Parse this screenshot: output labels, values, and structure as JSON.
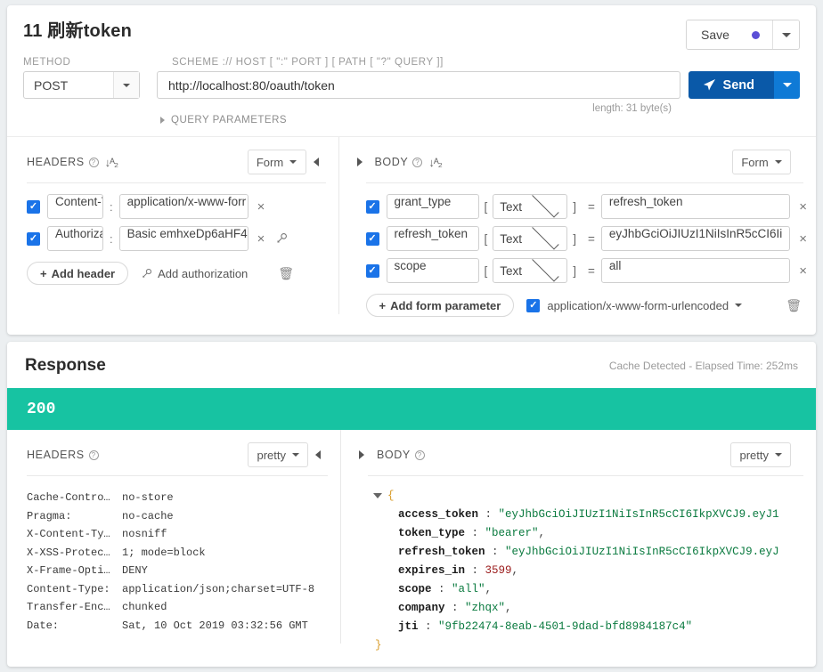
{
  "request": {
    "title": "11 刷新token",
    "save_label": "Save",
    "save_dot_color": "#5b4fd6",
    "method_label": "METHOD",
    "method_value": "POST",
    "scheme_label": "SCHEME :// HOST [ \":\" PORT ] [ PATH [ \"?\" QUERY ]]",
    "url_value": "http://localhost:80/oauth/token",
    "url_placeholder": "http://",
    "send_label": "Send",
    "length_note": "length: 31 byte(s)",
    "query_params_label": "QUERY PARAMETERS"
  },
  "headers_pane": {
    "title": "HEADERS",
    "mode": "Form",
    "rows": [
      {
        "name": "Content-T",
        "value": "application/x-www-forr",
        "checked": true,
        "has_key_icon": false
      },
      {
        "name": "Authorizat",
        "value": "Basic emhxeDp6aHF4",
        "checked": true,
        "has_key_icon": true
      }
    ],
    "add_header_label": "Add header",
    "add_authorization_label": "Add authorization"
  },
  "body_pane": {
    "title": "BODY",
    "mode": "Form",
    "rows": [
      {
        "name": "grant_type",
        "type": "Text",
        "value": "refresh_token",
        "checked": true
      },
      {
        "name": "refresh_token",
        "type": "Text",
        "value": "eyJhbGciOiJIUzI1NiIsInR5cCI6Ii",
        "checked": true
      },
      {
        "name": "scope",
        "type": "Text",
        "value": "all",
        "checked": true
      }
    ],
    "add_param_label": "Add form parameter",
    "content_type": "application/x-www-form-urlencoded",
    "content_type_checked": true
  },
  "response": {
    "title": "Response",
    "meta": "Cache Detected - Elapsed Time: 252ms",
    "status_code": "200",
    "status_color": "#17c3a2",
    "headers_pane": {
      "title": "HEADERS",
      "mode": "pretty",
      "rows": [
        {
          "key": "Cache-Contro…",
          "value": "no-store"
        },
        {
          "key": "Pragma:",
          "value": "no-cache"
        },
        {
          "key": "X-Content-Ty…",
          "value": "nosniff"
        },
        {
          "key": "X-XSS-Protec…",
          "value": "1; mode=block"
        },
        {
          "key": "X-Frame-Opti…",
          "value": "DENY"
        },
        {
          "key": "Content-Type:",
          "value": "application/json;charset=UTF-8"
        },
        {
          "key": "Transfer-Enc…",
          "value": "chunked"
        },
        {
          "key": "Date:",
          "value": "Sat, 10 Oct 2019 03:32:56 GMT"
        }
      ]
    },
    "body_pane": {
      "title": "BODY",
      "mode": "pretty",
      "open_brace": "{",
      "close_brace": "}",
      "fields": [
        {
          "key": "access_token",
          "value": "\"eyJhbGciOiJIUzI1NiIsInR5cCI6IkpXVCJ9.eyJ1",
          "type": "string",
          "comma": ""
        },
        {
          "key": "token_type",
          "value": "\"bearer\"",
          "type": "string",
          "comma": ","
        },
        {
          "key": "refresh_token",
          "value": "\"eyJhbGciOiJIUzI1NiIsInR5cCI6IkpXVCJ9.eyJ",
          "type": "string",
          "comma": ""
        },
        {
          "key": "expires_in",
          "value": "3599",
          "type": "number",
          "comma": ","
        },
        {
          "key": "scope",
          "value": "\"all\"",
          "type": "string",
          "comma": ","
        },
        {
          "key": "company",
          "value": "\"zhqx\"",
          "type": "string",
          "comma": ","
        },
        {
          "key": "jti",
          "value": "\"9fb22474-8eab-4501-9dad-bfd8984187c4\"",
          "type": "string",
          "comma": ""
        }
      ]
    }
  }
}
